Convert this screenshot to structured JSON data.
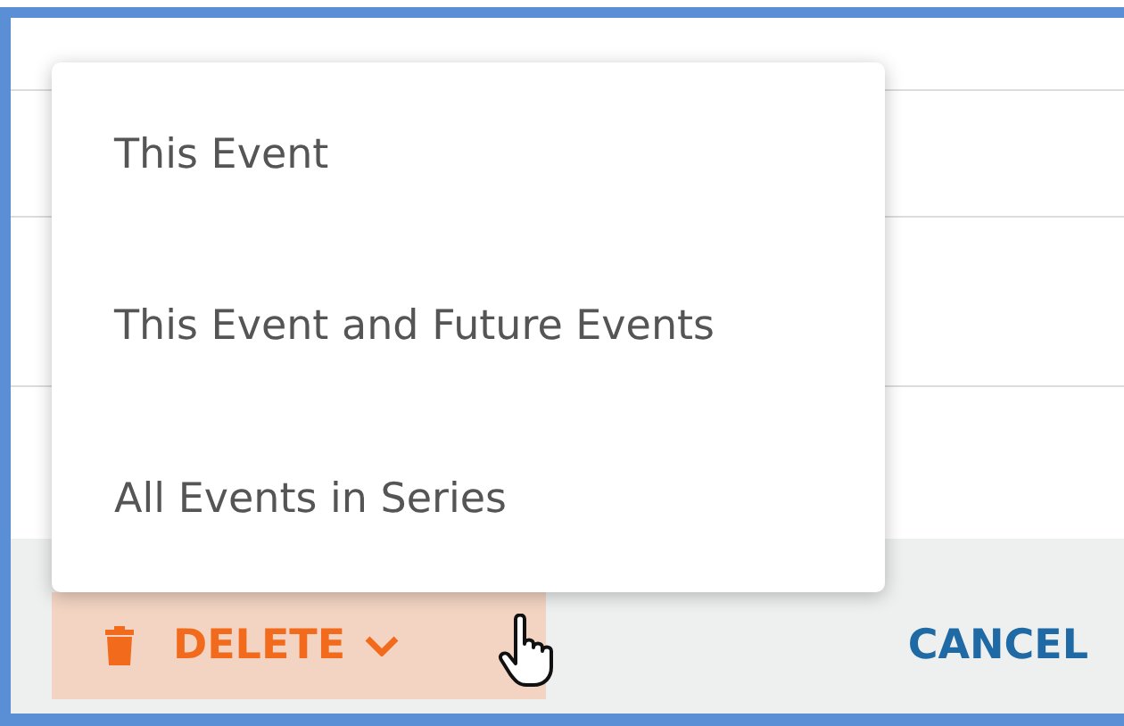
{
  "dropdown_menu": {
    "items": [
      {
        "label": "This Event"
      },
      {
        "label": "This Event and Future Events"
      },
      {
        "label": "All Events in Series"
      }
    ]
  },
  "footer": {
    "delete_button": {
      "label": "DELETE"
    },
    "cancel_button": {
      "label": "CANCEL"
    }
  }
}
